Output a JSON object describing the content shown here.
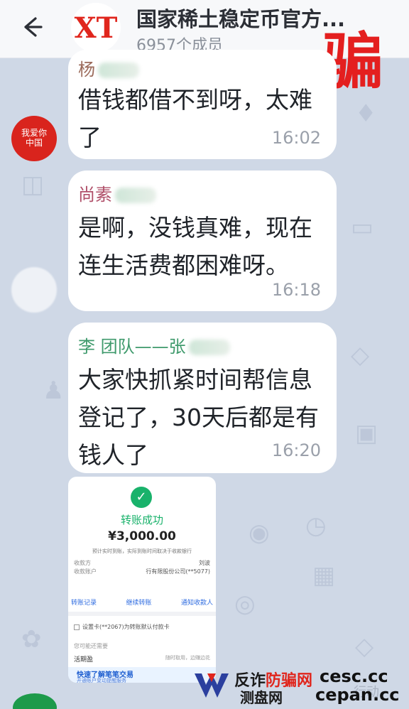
{
  "header": {
    "title": "国家稀土稳定币官方...",
    "member_count": "6957个成员",
    "group_avatar_text": "XT",
    "stamp": "骗"
  },
  "avatar_red": {
    "line1": "我爱你",
    "line2": "中国"
  },
  "messages": [
    {
      "sender": "杨",
      "sender_color": "#9b6a5a",
      "text": "借钱都借不到呀，太难了",
      "time": "16:02"
    },
    {
      "sender": "尚素",
      "sender_color": "#b0506a",
      "text": "是啊，没钱真难，现在连生活费都困难呀。",
      "time": "16:18"
    },
    {
      "sender": "李 团队——张",
      "sender_color": "#3f9a6c",
      "text": "大家快抓紧时间帮信息登记了，30天后都是有钱人了",
      "time": "16:20"
    }
  ],
  "transfer_card": {
    "status": "转账成功",
    "amount": "¥3,000.00",
    "note": "预计实时到账，实际到账时间取决于收款银行",
    "payee_label": "收款方",
    "payee_value": "刘波",
    "account_label": "收款账户",
    "account_value": "行有限股份公司(**5077)",
    "actions": [
      "转账记录",
      "继续转账",
      "通知收款人"
    ],
    "checkbox_label": "设置卡(**2067)为转账默认付款卡",
    "hint": "您可能还需要",
    "fund_label": "活期盈",
    "fund_right": "随时取用，边赚边花",
    "promo_title": "快速了解笔笔交易",
    "promo_sub": "开通账户变动提醒服务"
  },
  "watermark": {
    "line1_a": "反诈",
    "line1_b": "防骗网",
    "line2": "测盘网",
    "domain1": "cesc.cc",
    "domain2": "cepan.cc",
    "ghost": "行动"
  },
  "colors": {
    "background": "#cfd8e6",
    "stamp_red": "#e41f1f",
    "success_green": "#19b26b",
    "link_blue": "#2d6be0"
  }
}
